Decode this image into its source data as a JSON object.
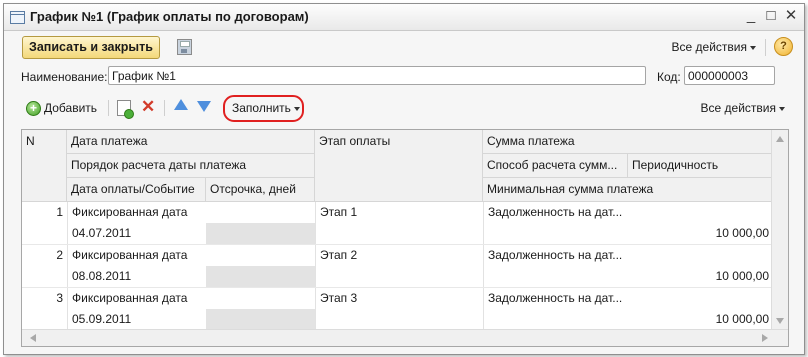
{
  "window": {
    "title": "График №1 (График оплаты по договорам)",
    "minimize_label": "_",
    "maximize_label": "□",
    "close_label": "✕"
  },
  "command_bar": {
    "save_close_label": "Записать и закрыть",
    "all_actions_label": "Все действия",
    "help_label": "?"
  },
  "fields": {
    "name_label": "Наименование:",
    "name_value": "График №1",
    "code_label": "Код:",
    "code_value": "000000003"
  },
  "toolbar": {
    "add_label": "Добавить",
    "fill_label": "Заполнить",
    "all_actions_label": "Все действия"
  },
  "table": {
    "headers": {
      "n": "N",
      "payment_date": "Дата платежа",
      "date_calc_order": "Порядок расчета даты платежа",
      "pay_date_event": "Дата оплаты/Событие",
      "delay_days": "Отсрочка, дней",
      "payment_stage": "Этап оплаты",
      "payment_amount": "Сумма платежа",
      "amount_calc_method": "Способ расчета сумм...",
      "periodicity": "Периодичность",
      "min_amount": "Минимальная сумма платежа"
    },
    "rows": [
      {
        "n": "1",
        "calc_order": "Фиксированная дата",
        "date": "04.07.2011",
        "stage": "Этап 1",
        "method": "Задолженность на дат...",
        "amount": "10 000,00"
      },
      {
        "n": "2",
        "calc_order": "Фиксированная дата",
        "date": "08.08.2011",
        "stage": "Этап 2",
        "method": "Задолженность на дат...",
        "amount": "10 000,00"
      },
      {
        "n": "3",
        "calc_order": "Фиксированная дата",
        "date": "05.09.2011",
        "stage": "Этап 3",
        "method": "Задолженность на дат...",
        "amount": "10 000,00"
      }
    ]
  }
}
